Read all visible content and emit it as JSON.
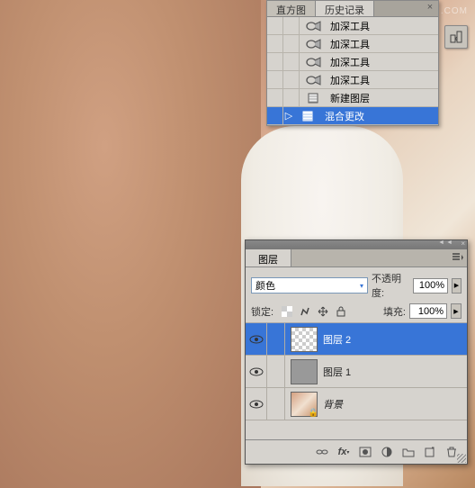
{
  "watermark": "WWW.MISSYUAN.COM",
  "history": {
    "tabs": {
      "histogram": "直方图",
      "history": "历史记录"
    },
    "items": [
      {
        "label": "加深工具",
        "icon": "burn",
        "selected": false
      },
      {
        "label": "加深工具",
        "icon": "burn",
        "selected": false
      },
      {
        "label": "加深工具",
        "icon": "burn",
        "selected": false
      },
      {
        "label": "加深工具",
        "icon": "burn",
        "selected": false
      },
      {
        "label": "新建图层",
        "icon": "newlayer",
        "selected": false
      },
      {
        "label": "混合更改",
        "icon": "blend",
        "selected": true
      }
    ]
  },
  "layers": {
    "title": "图层",
    "blend": {
      "label": "颜色",
      "opacity_label": "不透明度:",
      "opacity_value": "100%"
    },
    "lock": {
      "label": "锁定:",
      "fill_label": "填充:",
      "fill_value": "100%"
    },
    "items": [
      {
        "name": "图层 2",
        "thumb": "checker",
        "selected": true,
        "locked": false
      },
      {
        "name": "图层 1",
        "thumb": "gray",
        "selected": false,
        "locked": false
      },
      {
        "name": "背景",
        "thumb": "photo",
        "selected": false,
        "locked": true
      }
    ]
  }
}
